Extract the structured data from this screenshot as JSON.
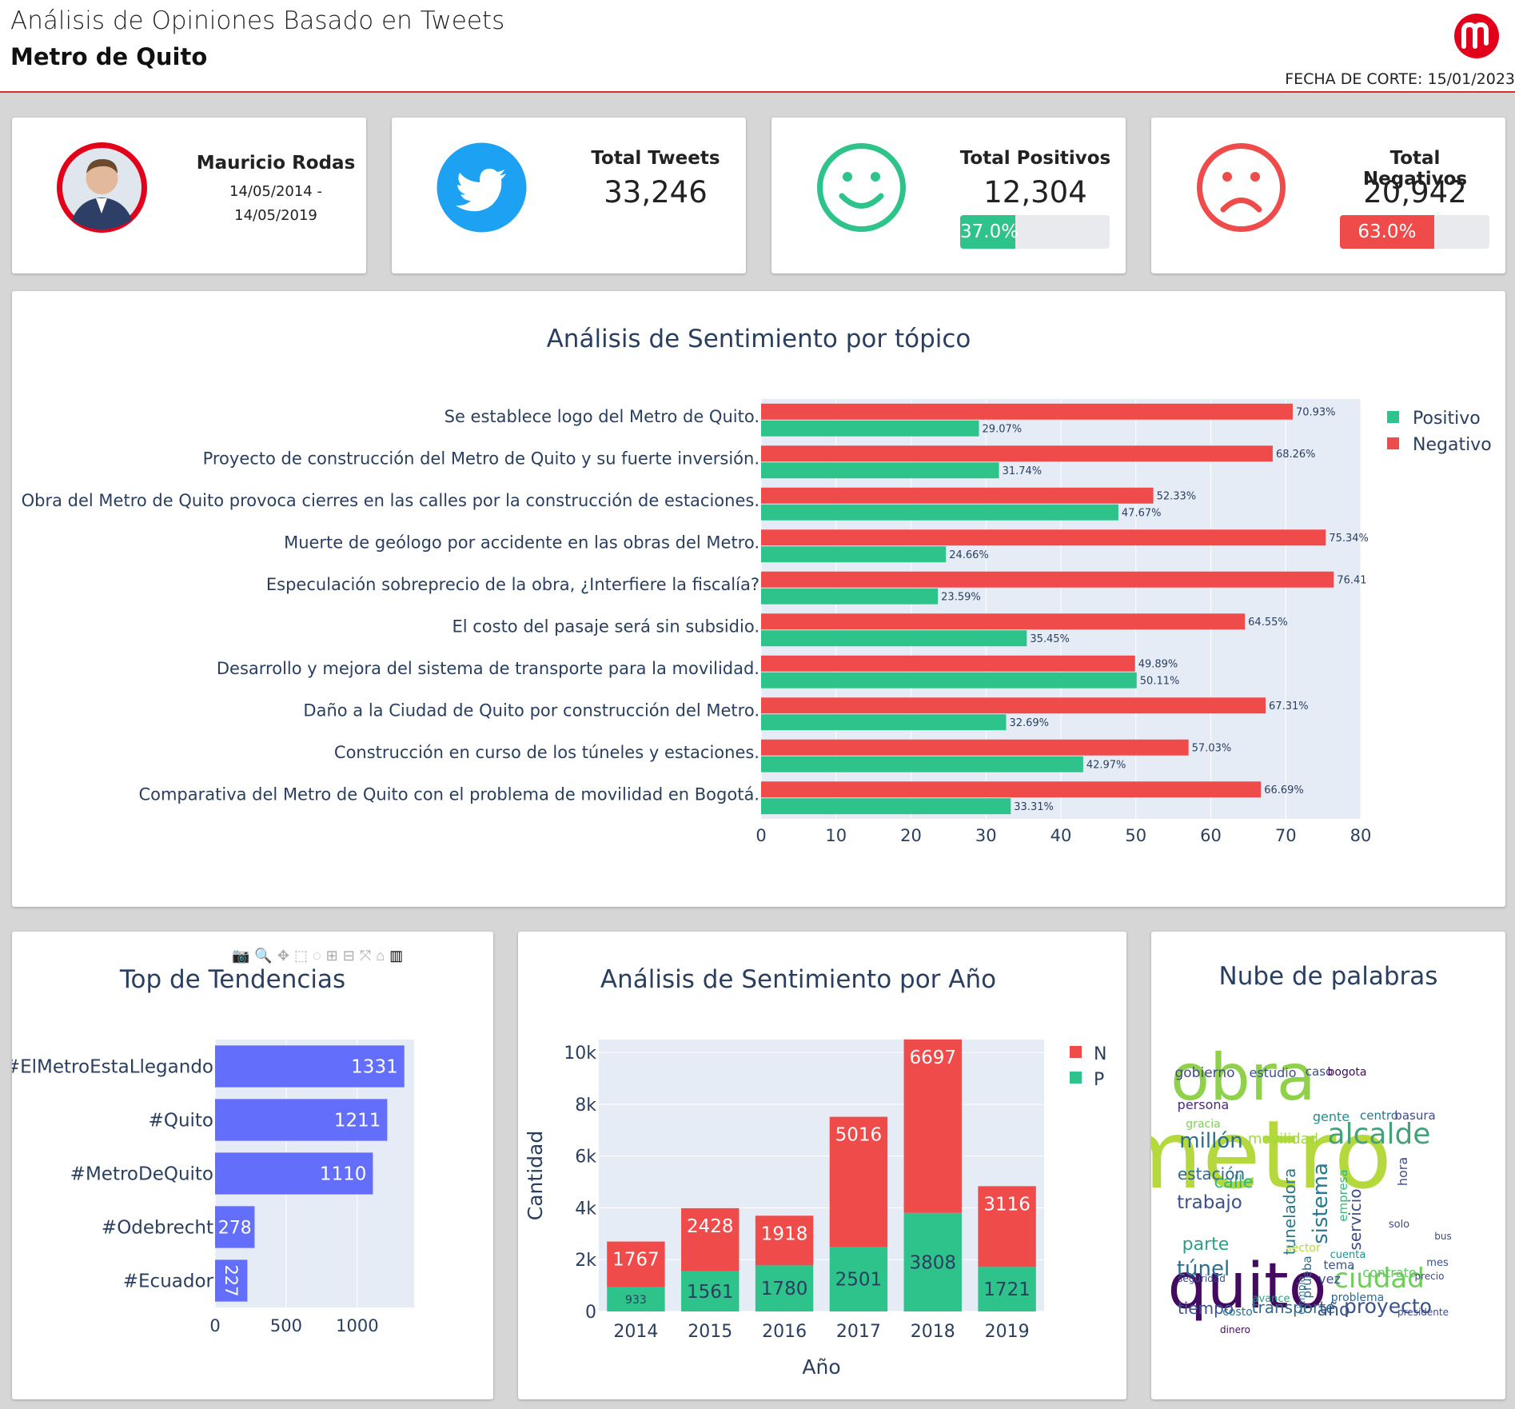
{
  "header": {
    "title": "Análisis de Opiniones Basado en Tweets",
    "subtitle": "Metro de Quito",
    "cutoff": "FECHA DE CORTE: 15/01/2023",
    "logo_icon": "metro-quito-logo-icon"
  },
  "kpis": {
    "person": {
      "name": "Mauricio Rodas",
      "period_start": "14/05/2014 -",
      "period_end": "14/05/2019",
      "icon": "person-avatar"
    },
    "tweets": {
      "title": "Total Tweets",
      "value": "33,246",
      "icon": "twitter-icon"
    },
    "positive": {
      "title": "Total Positivos",
      "value": "12,304",
      "percent_label": "37.0%",
      "percent": 37.0,
      "icon": "smile-face-icon"
    },
    "negative": {
      "title": "Total Negativos",
      "value": "20,942",
      "percent_label": "63.0%",
      "percent": 63.0,
      "icon": "sad-face-icon"
    }
  },
  "colors": {
    "positive": "#2dc38a",
    "negative": "#ef4b4b",
    "trend": "#636efa",
    "plot_bg": "#e5ecf6",
    "accent": "#e3001b",
    "twitter": "#1da1f2"
  },
  "chart_data": [
    {
      "type": "bar",
      "orientation": "horizontal",
      "title": "Análisis de Sentimiento por tópico",
      "categories": [
        "Se establece logo del Metro de Quito.",
        "Proyecto de construcción del Metro de Quito y su fuerte inversión.",
        "Obra del Metro de Quito provoca cierres en las calles por la construcción de estaciones.",
        "Muerte de geólogo por accidente en las obras del Metro.",
        "Especulación sobreprecio de la obra, ¿Interfiere la fiscalía?",
        "El costo del pasaje será sin subsidio.",
        "Desarrollo y mejora del sistema de transporte para la movilidad.",
        "Daño a la Ciudad de Quito por construcción del Metro.",
        "Construcción en curso de los túneles y estaciones.",
        "Comparativa del Metro de Quito con el problema de movilidad en Bogotá."
      ],
      "series": [
        {
          "name": "Positivo",
          "values": [
            29.07,
            31.74,
            47.67,
            24.66,
            23.59,
            35.45,
            50.11,
            32.69,
            42.97,
            33.31
          ],
          "labels": [
            "29.07%",
            "31.74%",
            "47.67%",
            "24.66%",
            "23.59%",
            "35.45%",
            "50.11%",
            "32.69%",
            "42.97%",
            "33.31%"
          ]
        },
        {
          "name": "Negativo",
          "values": [
            70.93,
            68.26,
            52.33,
            75.34,
            76.41,
            64.55,
            49.89,
            67.31,
            57.03,
            66.69
          ],
          "labels": [
            "70.93%",
            "68.26%",
            "52.33%",
            "75.34%",
            "76.41",
            "64.55%",
            "49.89%",
            "67.31%",
            "57.03%",
            "66.69%"
          ]
        }
      ],
      "xlim": [
        0,
        80
      ],
      "xticks": [
        "0",
        "10",
        "20",
        "30",
        "40",
        "50",
        "60",
        "70",
        "80"
      ],
      "legend": "top-right"
    },
    {
      "type": "bar",
      "orientation": "horizontal",
      "title": "Top de Tendencias",
      "categories": [
        "#ElMetroEstaLlegando",
        "#Quito",
        "#MetroDeQuito",
        "#Odebrecht",
        "#Ecuador"
      ],
      "values": [
        1331,
        1211,
        1110,
        278,
        227
      ],
      "xlim": [
        0,
        1400
      ],
      "xticks": [
        "0",
        "500",
        "1000"
      ]
    },
    {
      "type": "bar",
      "stacked": true,
      "title": "Análisis de Sentimiento por Año",
      "xlabel": "Año",
      "ylabel": "Cantidad",
      "categories": [
        "2014",
        "2015",
        "2016",
        "2017",
        "2018",
        "2019"
      ],
      "series": [
        {
          "name": "N",
          "values": [
            1767,
            2428,
            1918,
            5016,
            6697,
            3116
          ]
        },
        {
          "name": "P",
          "values": [
            933,
            1561,
            1780,
            2501,
            3808,
            1721
          ]
        }
      ],
      "ylim": [
        0,
        10500
      ],
      "yticks": [
        "0",
        "2k",
        "4k",
        "6k",
        "8k",
        "10k"
      ],
      "legend": "top-right"
    }
  ],
  "cloud": {
    "title": "Nube de palabras",
    "words": [
      "metro",
      "obra",
      "quito",
      "alcalde",
      "ciudad",
      "millón",
      "túnel",
      "proyecto",
      "trabajo",
      "calle",
      "estación",
      "parte",
      "tiempo",
      "transporte",
      "movilidad",
      "gobierno",
      "estudio",
      "caso",
      "bogota",
      "persona",
      "gracia",
      "gente",
      "centro",
      "basura",
      "contrato",
      "seguridad",
      "avance",
      "costo",
      "precio",
      "mes",
      "año",
      "sistema",
      "tuneladora",
      "servicio",
      "hora",
      "empresa",
      "presidente",
      "problema",
      "sector",
      "ejemplo",
      "prueba",
      "cuenta",
      "vez",
      "tema",
      "dinero",
      "solo",
      "bus"
    ]
  },
  "modebar": {
    "icons": [
      "camera-icon",
      "zoom-icon",
      "pan-icon",
      "box-select-icon",
      "lasso-icon",
      "zoom-in-icon",
      "zoom-out-icon",
      "autoscale-icon",
      "home-icon",
      "plotly-logo-icon"
    ]
  }
}
